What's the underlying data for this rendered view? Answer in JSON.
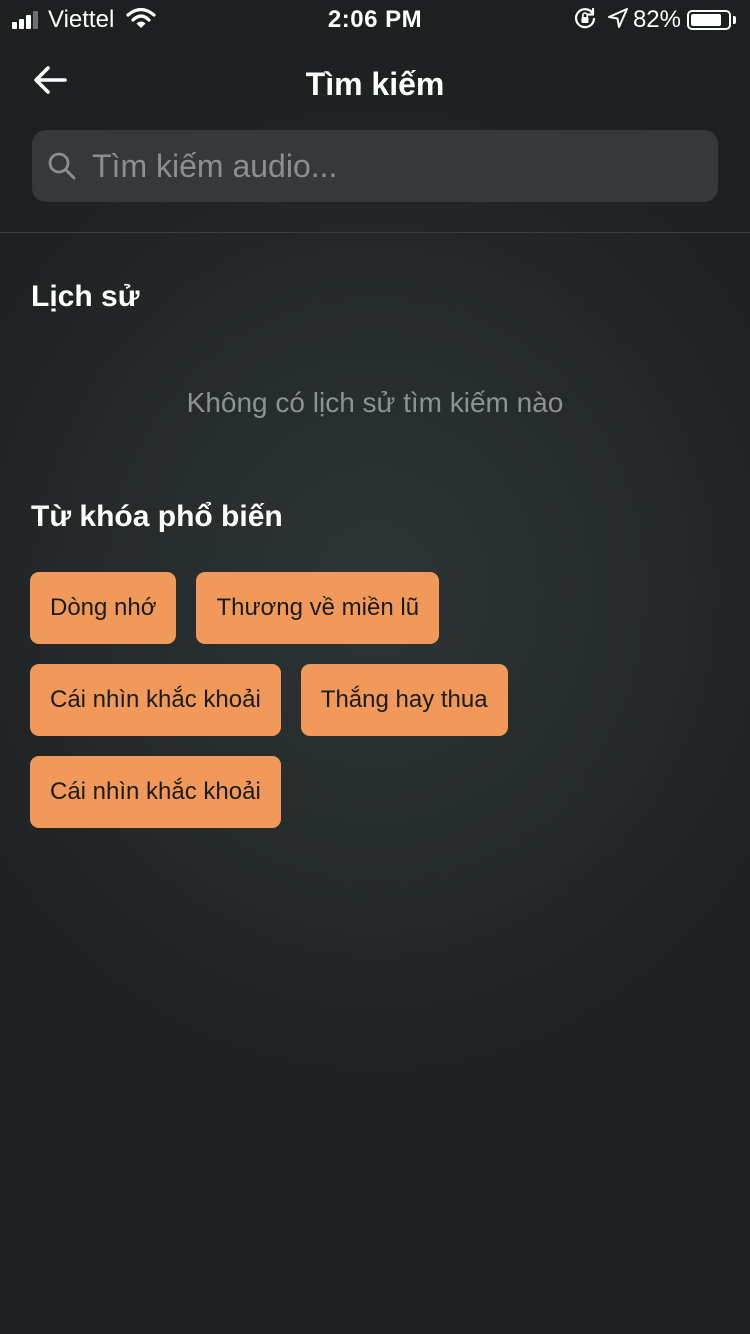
{
  "status_bar": {
    "carrier": "Viettel",
    "time": "2:06 PM",
    "battery_percent": "82%",
    "battery_level": 0.82,
    "icons": [
      "signal-icon",
      "wifi-icon",
      "rotation-lock-icon",
      "location-arrow-icon",
      "battery-icon"
    ]
  },
  "header": {
    "title": "Tìm kiếm",
    "back_icon": "arrow-left-icon"
  },
  "search": {
    "placeholder": "Tìm kiếm audio...",
    "value": "",
    "icon": "search-icon"
  },
  "history": {
    "title": "Lịch sử",
    "empty_text": "Không có lịch sử tìm kiếm nào"
  },
  "popular": {
    "title": "Từ khóa phổ biến",
    "keywords": [
      {
        "label": "Dòng nhớ"
      },
      {
        "label": "Thương về miền lũ"
      },
      {
        "label": "Cái nhìn khắc khoải"
      },
      {
        "label": "Thắng hay thua"
      },
      {
        "label": "Cái nhìn khắc khoải"
      }
    ]
  },
  "colors": {
    "chip_background": "#f0995a",
    "chip_text": "#1b1b1b",
    "background": "#1d1f20",
    "search_background": "#35393b",
    "muted_text": "#8d9294"
  }
}
